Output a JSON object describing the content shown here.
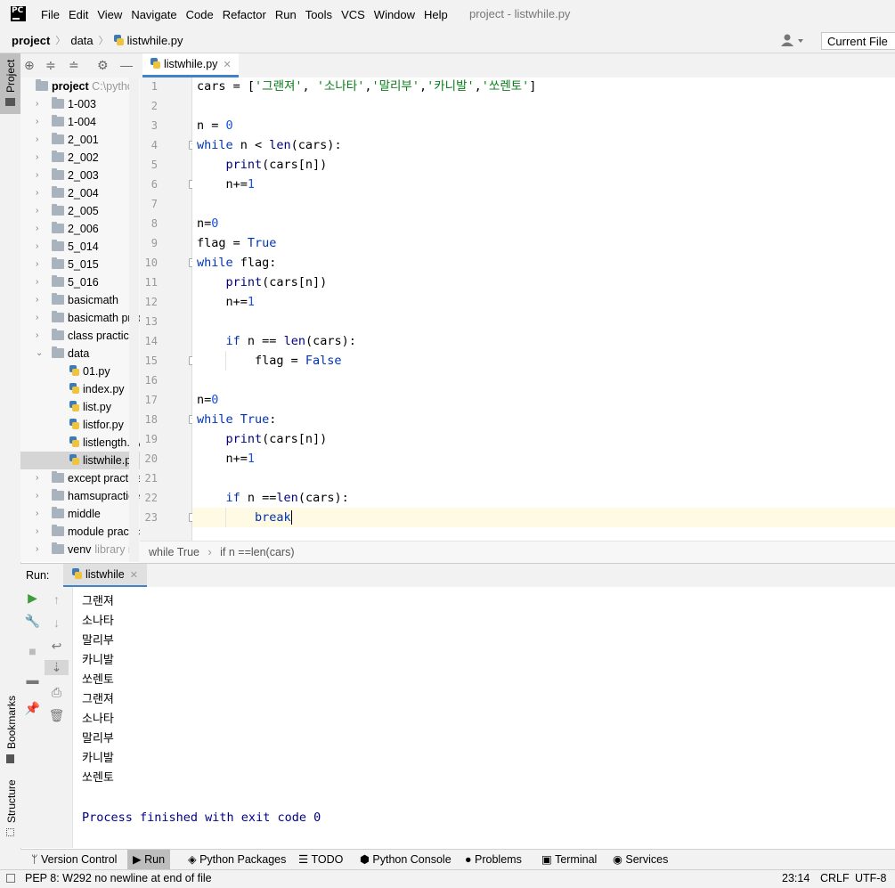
{
  "app": {
    "title": "project - listwhile.py",
    "logo": "PC"
  },
  "menu": [
    "File",
    "Edit",
    "View",
    "Navigate",
    "Code",
    "Refactor",
    "Run",
    "Tools",
    "VCS",
    "Window",
    "Help"
  ],
  "breadcrumb": {
    "project": "project",
    "folder": "data",
    "file": "listwhile.py"
  },
  "run_config": "Current File",
  "side_tabs": {
    "project": "Project",
    "bookmarks": "Bookmarks",
    "structure": "Structure"
  },
  "tree": {
    "root": "project",
    "root_hint": "C:\\pytho",
    "items": [
      {
        "label": "1-003",
        "type": "folder"
      },
      {
        "label": "1-004",
        "type": "folder"
      },
      {
        "label": "2_001",
        "type": "folder"
      },
      {
        "label": "2_002",
        "type": "folder"
      },
      {
        "label": "2_003",
        "type": "folder"
      },
      {
        "label": "2_004",
        "type": "folder"
      },
      {
        "label": "2_005",
        "type": "folder"
      },
      {
        "label": "2_006",
        "type": "folder"
      },
      {
        "label": "5_014",
        "type": "folder"
      },
      {
        "label": "5_015",
        "type": "folder"
      },
      {
        "label": "5_016",
        "type": "folder"
      },
      {
        "label": "basicmath",
        "type": "folder"
      },
      {
        "label": "basicmath prac",
        "type": "folder"
      },
      {
        "label": "class practice",
        "type": "folder"
      },
      {
        "label": "data",
        "type": "folder-open"
      },
      {
        "label": "01.py",
        "type": "file"
      },
      {
        "label": "index.py",
        "type": "file"
      },
      {
        "label": "list.py",
        "type": "file"
      },
      {
        "label": "listfor.py",
        "type": "file"
      },
      {
        "label": "listlength.py",
        "type": "file"
      },
      {
        "label": "listwhile.py",
        "type": "file",
        "selected": true
      },
      {
        "label": "except practice",
        "type": "folder"
      },
      {
        "label": "hamsupractice",
        "type": "folder"
      },
      {
        "label": "middle",
        "type": "folder"
      },
      {
        "label": "module practic",
        "type": "folder"
      },
      {
        "label": "venv",
        "type": "folder",
        "hint": "library ro"
      }
    ]
  },
  "editor": {
    "tab": "listwhile.py",
    "lines": [
      "cars = ['그랜져', '소나타','말리부','카니발','쏘렌토']",
      "",
      "n = 0",
      "while n < len(cars):",
      "    print(cars[n])",
      "    n+=1",
      "",
      "n=0",
      "flag = True",
      "while flag:",
      "    print(cars[n])",
      "    n+=1",
      "",
      "    if n == len(cars):",
      "        flag = False",
      "",
      "n=0",
      "while True:",
      "    print(cars[n])",
      "    n+=1",
      "",
      "    if n ==len(cars):",
      "        break"
    ],
    "current_line": 23,
    "breadcrumb": [
      "while True",
      "if n ==len(cars)"
    ]
  },
  "run": {
    "label": "Run:",
    "tab": "listwhile",
    "output": [
      "그랜져",
      "소나타",
      "말리부",
      "카니발",
      "쏘렌토",
      "그랜져",
      "소나타",
      "말리부",
      "카니발",
      "쏘렌토"
    ],
    "exit_message": "Process finished with exit code 0"
  },
  "bottom_tabs": [
    "Version Control",
    "Run",
    "Python Packages",
    "TODO",
    "Python Console",
    "Problems",
    "Terminal",
    "Services"
  ],
  "status": {
    "message": "PEP 8: W292 no newline at end of file",
    "position": "23:14",
    "line_sep": "CRLF",
    "encoding": "UTF-8"
  }
}
